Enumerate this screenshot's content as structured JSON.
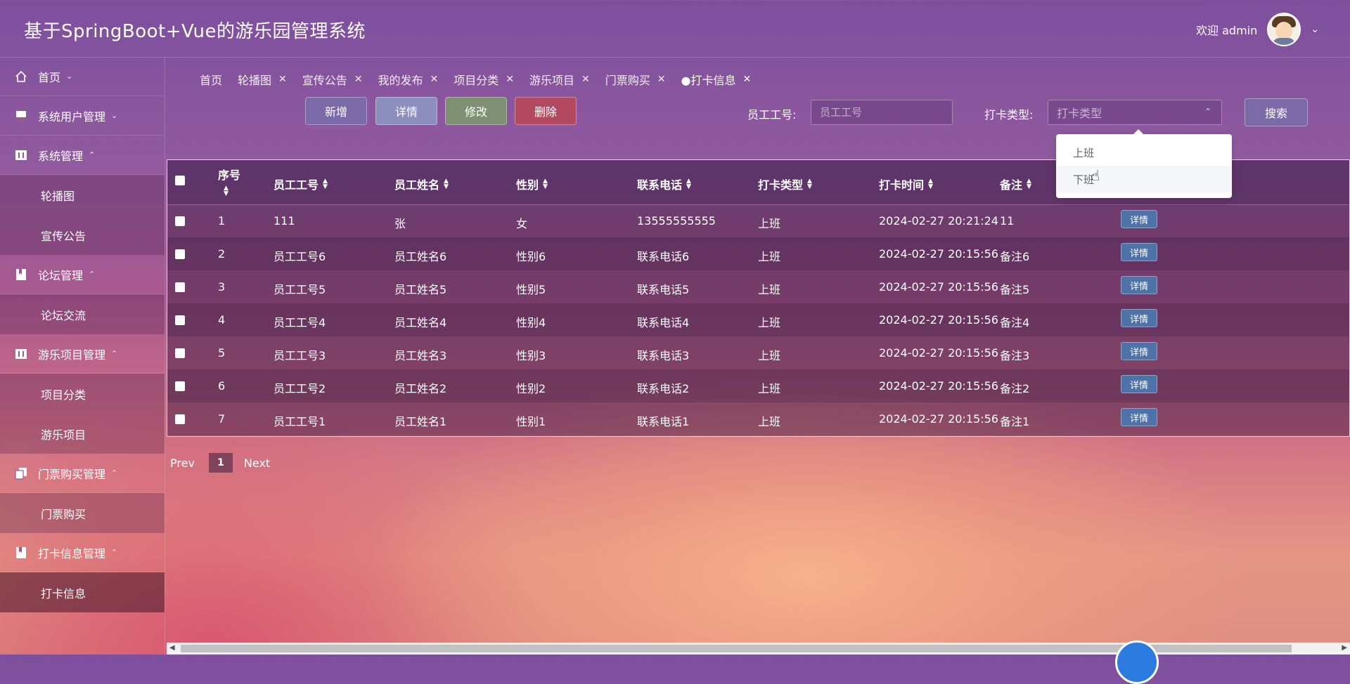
{
  "header": {
    "title": "基于SpringBoot+Vue的游乐园管理系统",
    "welcome": "欢迎 admin"
  },
  "sidebar": {
    "groups": [
      {
        "label": "首页",
        "icon": "home-icon"
      },
      {
        "label": "系统用户管理",
        "icon": "image-icon"
      },
      {
        "label": "系统管理",
        "icon": "sliders-icon",
        "items": [
          "轮播图",
          "宣传公告"
        ]
      },
      {
        "label": "论坛管理",
        "icon": "bookmark-icon",
        "items": [
          "论坛交流"
        ]
      },
      {
        "label": "游乐项目管理",
        "icon": "sliders-icon",
        "items": [
          "项目分类",
          "游乐项目"
        ]
      },
      {
        "label": "门票购买管理",
        "icon": "copy-icon",
        "items": [
          "门票购买"
        ]
      },
      {
        "label": "打卡信息管理",
        "icon": "bookmark-icon",
        "items": [
          "打卡信息"
        ]
      }
    ]
  },
  "tabs": [
    "首页",
    "轮播图",
    "宣传公告",
    "我的发布",
    "项目分类",
    "游乐项目",
    "门票购买",
    "●打卡信息"
  ],
  "actions": {
    "add": "新增",
    "detail": "详情",
    "edit": "修改",
    "delete": "删除"
  },
  "search": {
    "emp_label": "员工工号:",
    "emp_placeholder": "员工工号",
    "type_label": "打卡类型:",
    "type_placeholder": "打卡类型",
    "button": "搜索",
    "options": [
      "上班",
      "下班"
    ]
  },
  "table": {
    "headers": [
      "序号",
      "员工工号",
      "员工姓名",
      "性别",
      "联系电话",
      "打卡类型",
      "打卡时间",
      "备注"
    ],
    "detail_btn": "详情",
    "rows": [
      [
        "1",
        "111",
        "张",
        "女",
        "13555555555",
        "上班",
        "2024-02-27 20:21:24",
        "11"
      ],
      [
        "2",
        "员工工号6",
        "员工姓名6",
        "性别6",
        "联系电话6",
        "上班",
        "2024-02-27 20:15:56",
        "备注6"
      ],
      [
        "3",
        "员工工号5",
        "员工姓名5",
        "性别5",
        "联系电话5",
        "上班",
        "2024-02-27 20:15:56",
        "备注5"
      ],
      [
        "4",
        "员工工号4",
        "员工姓名4",
        "性别4",
        "联系电话4",
        "上班",
        "2024-02-27 20:15:56",
        "备注4"
      ],
      [
        "5",
        "员工工号3",
        "员工姓名3",
        "性别3",
        "联系电话3",
        "上班",
        "2024-02-27 20:15:56",
        "备注3"
      ],
      [
        "6",
        "员工工号2",
        "员工姓名2",
        "性别2",
        "联系电话2",
        "上班",
        "2024-02-27 20:15:56",
        "备注2"
      ],
      [
        "7",
        "员工工号1",
        "员工姓名1",
        "性别1",
        "联系电话1",
        "上班",
        "2024-02-27 20:15:56",
        "备注1"
      ]
    ]
  },
  "pager": {
    "prev": "Prev",
    "page": "1",
    "next": "Next"
  }
}
